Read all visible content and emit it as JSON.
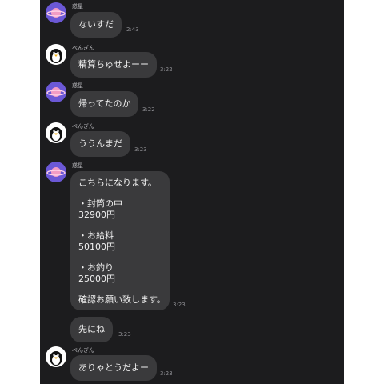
{
  "messages": [
    {
      "sender": "惑星",
      "avatar": "planet-icon",
      "text": "ないすだ",
      "time": "2:43"
    },
    {
      "sender": "ぺんぎん",
      "avatar": "penguin-icon",
      "text": "精算ちゅせよーー",
      "time": "3:22"
    },
    {
      "sender": "惑星",
      "avatar": "planet-icon",
      "text": "帰ってたのか",
      "time": "3:22"
    },
    {
      "sender": "ぺんぎん",
      "avatar": "penguin-icon",
      "text": "ううんまだ",
      "time": "3:23"
    },
    {
      "sender": "惑星",
      "avatar": "planet-icon",
      "lines": [
        "こちらになります。",
        "・封筒の中",
        "32900円",
        "・お給料",
        "50100円",
        "・お釣り",
        "25000円",
        "確認お願い致します。"
      ],
      "time": "3:23"
    },
    {
      "text": "先にね",
      "time": "3:23"
    },
    {
      "sender": "ぺんぎん",
      "avatar": "penguin-icon",
      "text": "ありゃとうだよー",
      "time": "3:23"
    }
  ],
  "colors": {
    "background": "#1c1c1e",
    "bubble": "#3a3a3c",
    "planet_avatar": "#6b58d6"
  }
}
